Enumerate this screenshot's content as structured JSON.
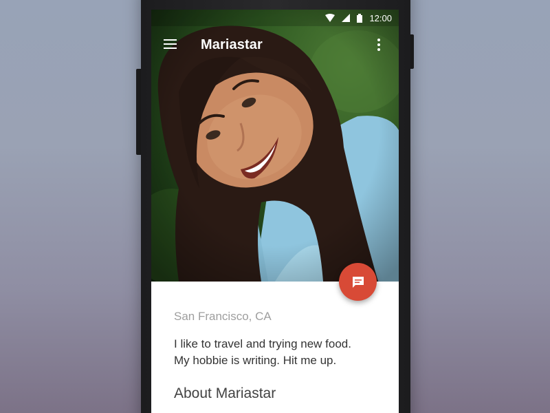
{
  "status_bar": {
    "time": "12:00",
    "icons": [
      "wifi-icon",
      "signal-icon",
      "battery-icon"
    ]
  },
  "app_bar": {
    "title": "Mariastar",
    "left_icon": "menu-icon",
    "right_icon": "more-vert-icon"
  },
  "fab": {
    "icon": "chat-icon",
    "color": "#d84a36"
  },
  "profile": {
    "location": "San Francisco, CA",
    "bio_lines": [
      "I like to travel and trying new food.",
      "My hobbie is writing. Hit me up."
    ],
    "section_title": "About Mariastar"
  },
  "colors": {
    "accent": "#d84a36",
    "text_primary": "#333333",
    "text_secondary": "#9e9e9e"
  }
}
